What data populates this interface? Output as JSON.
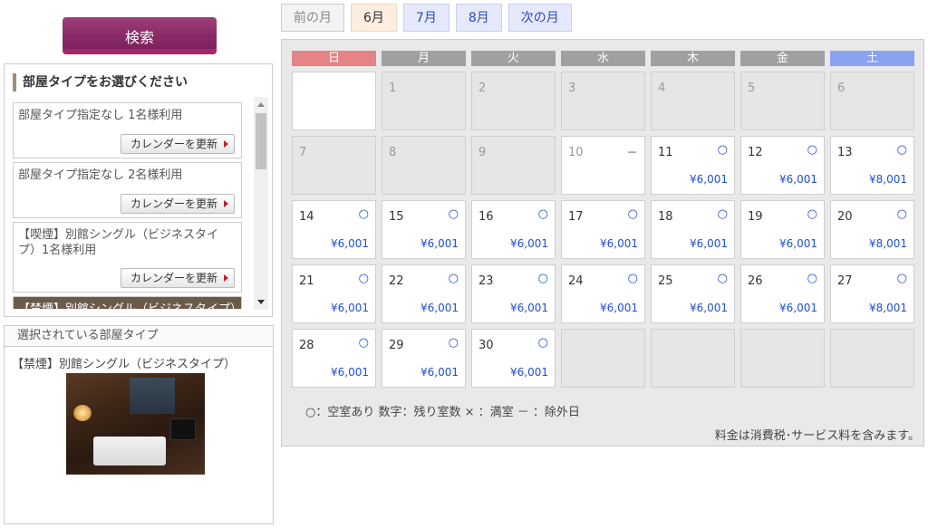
{
  "search": {
    "label": "検索"
  },
  "room_panel": {
    "title": "部屋タイプをお選びください",
    "items": [
      {
        "name": "部屋タイプ指定なし 1名様利用",
        "update": "カレンダーを更新"
      },
      {
        "name": "部屋タイプ指定なし 2名様利用",
        "update": "カレンダーを更新"
      },
      {
        "name": "【喫煙】別館シングル（ビジネスタイプ）1名様利用",
        "update": "カレンダーを更新"
      },
      {
        "name": "【禁煙】別館シングル（ビジネスタイプ）",
        "update": ""
      }
    ]
  },
  "selected": {
    "header": "選択されている部屋タイプ",
    "name": "【禁煙】別館シングル（ビジネスタイプ）"
  },
  "months": {
    "prev": "前の月",
    "current": "6月",
    "m7": "7月",
    "m8": "8月",
    "next": "次の月"
  },
  "calendar": {
    "weekdays": [
      "日",
      "月",
      "火",
      "水",
      "木",
      "金",
      "土"
    ],
    "weekday_colors": [
      "#e48484",
      "#a0a0a0",
      "#a0a0a0",
      "#a0a0a0",
      "#a0a0a0",
      "#a0a0a0",
      "#8aa3f1"
    ],
    "cells": [
      {
        "day": "",
        "status": "",
        "price": "",
        "type": "white"
      },
      {
        "day": "1",
        "status": "",
        "price": "",
        "type": "blank"
      },
      {
        "day": "2",
        "status": "",
        "price": "",
        "type": "blank"
      },
      {
        "day": "3",
        "status": "",
        "price": "",
        "type": "blank"
      },
      {
        "day": "4",
        "status": "",
        "price": "",
        "type": "blank"
      },
      {
        "day": "5",
        "status": "",
        "price": "",
        "type": "blank"
      },
      {
        "day": "6",
        "status": "",
        "price": "",
        "type": "blank"
      },
      {
        "day": "7",
        "status": "",
        "price": "",
        "type": "blank"
      },
      {
        "day": "8",
        "status": "",
        "price": "",
        "type": "blank"
      },
      {
        "day": "9",
        "status": "",
        "price": "",
        "type": "blank"
      },
      {
        "day": "10",
        "status": "－",
        "price": "",
        "type": "off"
      },
      {
        "day": "11",
        "status": "○",
        "price": "¥6,001",
        "type": "open"
      },
      {
        "day": "12",
        "status": "○",
        "price": "¥6,001",
        "type": "open"
      },
      {
        "day": "13",
        "status": "○",
        "price": "¥8,001",
        "type": "open"
      },
      {
        "day": "14",
        "status": "○",
        "price": "¥6,001",
        "type": "open"
      },
      {
        "day": "15",
        "status": "○",
        "price": "¥6,001",
        "type": "open"
      },
      {
        "day": "16",
        "status": "○",
        "price": "¥6,001",
        "type": "open"
      },
      {
        "day": "17",
        "status": "○",
        "price": "¥6,001",
        "type": "open"
      },
      {
        "day": "18",
        "status": "○",
        "price": "¥6,001",
        "type": "open"
      },
      {
        "day": "19",
        "status": "○",
        "price": "¥6,001",
        "type": "open"
      },
      {
        "day": "20",
        "status": "○",
        "price": "¥8,001",
        "type": "open"
      },
      {
        "day": "21",
        "status": "○",
        "price": "¥6,001",
        "type": "open"
      },
      {
        "day": "22",
        "status": "○",
        "price": "¥6,001",
        "type": "open"
      },
      {
        "day": "23",
        "status": "○",
        "price": "¥6,001",
        "type": "open"
      },
      {
        "day": "24",
        "status": "○",
        "price": "¥6,001",
        "type": "open"
      },
      {
        "day": "25",
        "status": "○",
        "price": "¥6,001",
        "type": "open"
      },
      {
        "day": "26",
        "status": "○",
        "price": "¥6,001",
        "type": "open"
      },
      {
        "day": "27",
        "status": "○",
        "price": "¥8,001",
        "type": "open"
      },
      {
        "day": "28",
        "status": "○",
        "price": "¥6,001",
        "type": "open"
      },
      {
        "day": "29",
        "status": "○",
        "price": "¥6,001",
        "type": "open"
      },
      {
        "day": "30",
        "status": "○",
        "price": "¥6,001",
        "type": "open"
      },
      {
        "day": "",
        "status": "",
        "price": "",
        "type": "blank"
      },
      {
        "day": "",
        "status": "",
        "price": "",
        "type": "blank"
      },
      {
        "day": "",
        "status": "",
        "price": "",
        "type": "blank"
      },
      {
        "day": "",
        "status": "",
        "price": "",
        "type": "blank"
      }
    ],
    "legend": "○：空室あり 数字：残り室数 × ：満室 － ：除外日",
    "note": "料金は消費税･サービス料を含みます。"
  }
}
